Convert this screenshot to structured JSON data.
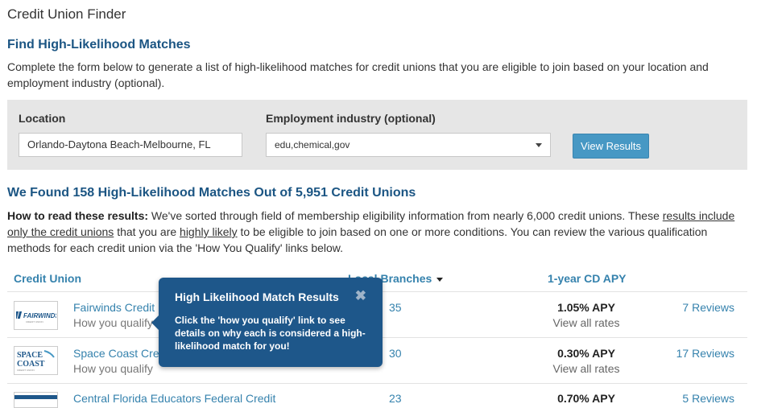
{
  "page": {
    "title": "Credit Union Finder",
    "section_heading": "Find High-Likelihood Matches",
    "intro_text": "Complete the form below to generate a list of high-likelihood matches for credit unions that you are eligible to join based on your location and employment industry (optional)."
  },
  "form": {
    "location_label": "Location",
    "location_value": "Orlando-Daytona Beach-Melbourne, FL",
    "industry_label": "Employment industry (optional)",
    "industry_value": "edu,chemical,gov",
    "submit_label": "View Results"
  },
  "results": {
    "heading": "We Found 158 High-Likelihood Matches Out of 5,951 Credit Unions",
    "how_label": "How to read these results:",
    "how_text_1": " We've sorted through field of membership eligibility information from nearly 6,000 credit unions. These ",
    "how_link_1": "results include only the credit unions",
    "how_text_2": " that you are ",
    "how_link_2": "highly likely",
    "how_text_3": " to be eligible to join based on one or more conditions. You can review the various qualification methods for each credit union via the 'How You Qualify' links below."
  },
  "table": {
    "col_credit_union": "Credit Union",
    "col_branches": "Local Branches",
    "col_apy": "1-year CD APY",
    "rows": [
      {
        "name": "Fairwinds Credit Union",
        "qualify": "How you qualify",
        "branches": "35",
        "apy": "1.05% APY",
        "view_all": "View all rates",
        "reviews": "7 Reviews",
        "logo": "FAIRWINDS"
      },
      {
        "name": "Space Coast Credit Union",
        "qualify": "How you qualify",
        "branches": "30",
        "apy": "0.30% APY",
        "view_all": "View all rates",
        "reviews": "17 Reviews",
        "logo": "SPACE COAST"
      },
      {
        "name": "Central Florida Educators Federal Credit",
        "qualify": "",
        "branches": "23",
        "apy": "0.70% APY",
        "view_all": "",
        "reviews": "5 Reviews",
        "logo": ""
      }
    ]
  },
  "popover": {
    "title": "High Likelihood Match Results",
    "close_glyph": "✖",
    "body": "Click the 'how you qualify' link to see details on why each is considered a high-likelihood match for you!"
  },
  "colors": {
    "heading_blue": "#1b5583",
    "link_blue": "#3582ad",
    "button_blue": "#4798c4",
    "popover_bg": "#1e578a",
    "panel_gray": "#e6e6e6"
  }
}
